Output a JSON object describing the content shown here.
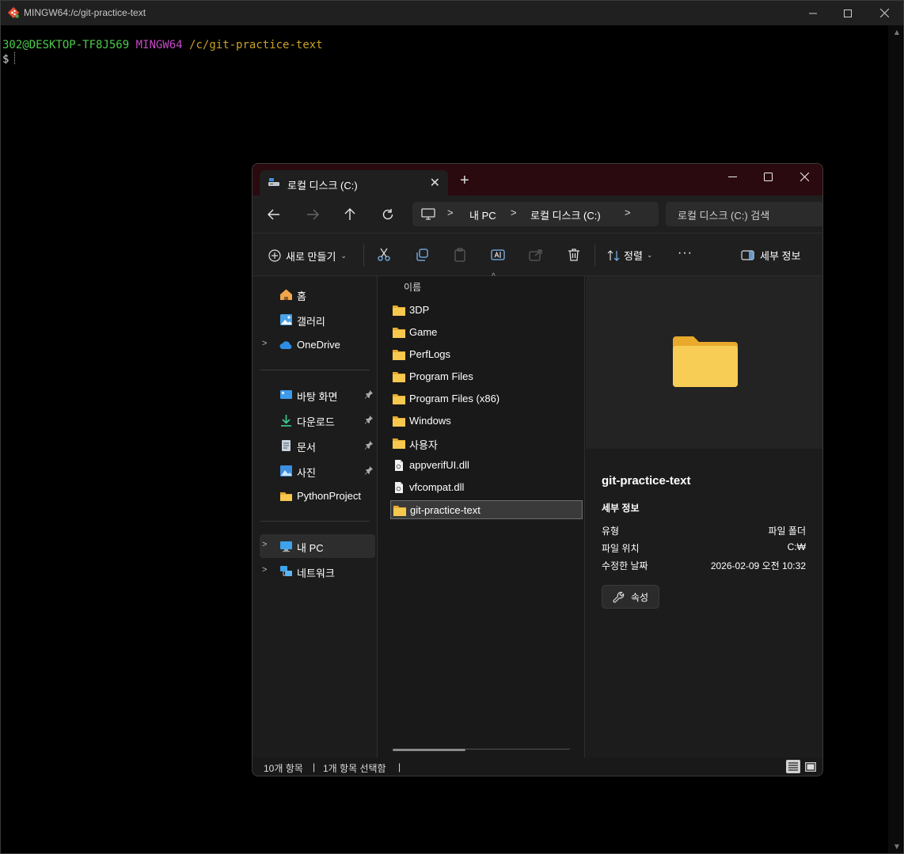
{
  "terminal": {
    "title": "MINGW64:/c/git-practice-text",
    "prompt_user": "302@DESKTOP-TF8J569",
    "prompt_env": "MINGW64",
    "prompt_path": "/c/git-practice-text",
    "prompt_symbol": "$"
  },
  "explorer": {
    "tab_label": "로컬 디스크 (C:)",
    "breadcrumb": [
      "내 PC",
      "로컬 디스크 (C:)"
    ],
    "search_placeholder": "로컬 디스크 (C:) 검색",
    "toolbar": {
      "new_label": "새로 만들기",
      "sort_label": "정렬",
      "more_label": "···",
      "details_label": "세부 정보"
    },
    "nav": {
      "home": "홈",
      "gallery": "갤러리",
      "onedrive": "OneDrive",
      "desktop": "바탕 화면",
      "downloads": "다운로드",
      "documents": "문서",
      "pictures": "사진",
      "python_project": "PythonProject",
      "this_pc": "내 PC",
      "network": "네트워크"
    },
    "column_header": "이름",
    "files": [
      {
        "name": "3DP",
        "type": "folder"
      },
      {
        "name": "Game",
        "type": "folder"
      },
      {
        "name": "PerfLogs",
        "type": "folder"
      },
      {
        "name": "Program Files",
        "type": "folder"
      },
      {
        "name": "Program Files (x86)",
        "type": "folder"
      },
      {
        "name": "Windows",
        "type": "folder"
      },
      {
        "name": "사용자",
        "type": "folder"
      },
      {
        "name": "appverifUI.dll",
        "type": "file"
      },
      {
        "name": "vfcompat.dll",
        "type": "file"
      },
      {
        "name": "git-practice-text",
        "type": "folder",
        "selected": true
      }
    ],
    "details": {
      "name": "git-practice-text",
      "section_title": "세부 정보",
      "type_key": "유형",
      "type_value": "파일 폴더",
      "location_key": "파일 위치",
      "location_value": "C:₩",
      "modified_key": "수정한 날짜",
      "modified_value": "2026-02-09 오전 10:32",
      "properties_label": "속성"
    },
    "status": {
      "item_count": "10개 항목",
      "selected_count": "1개 항목 선택함",
      "separator": "|"
    }
  },
  "colors": {
    "terminal_bg": "#000000",
    "prompt_user": "#4ec94e",
    "prompt_env": "#c54ac5",
    "prompt_path": "#c9a224",
    "explorer_tabbar": "#2a0a0f",
    "folder_yellow": "#f3c042"
  }
}
